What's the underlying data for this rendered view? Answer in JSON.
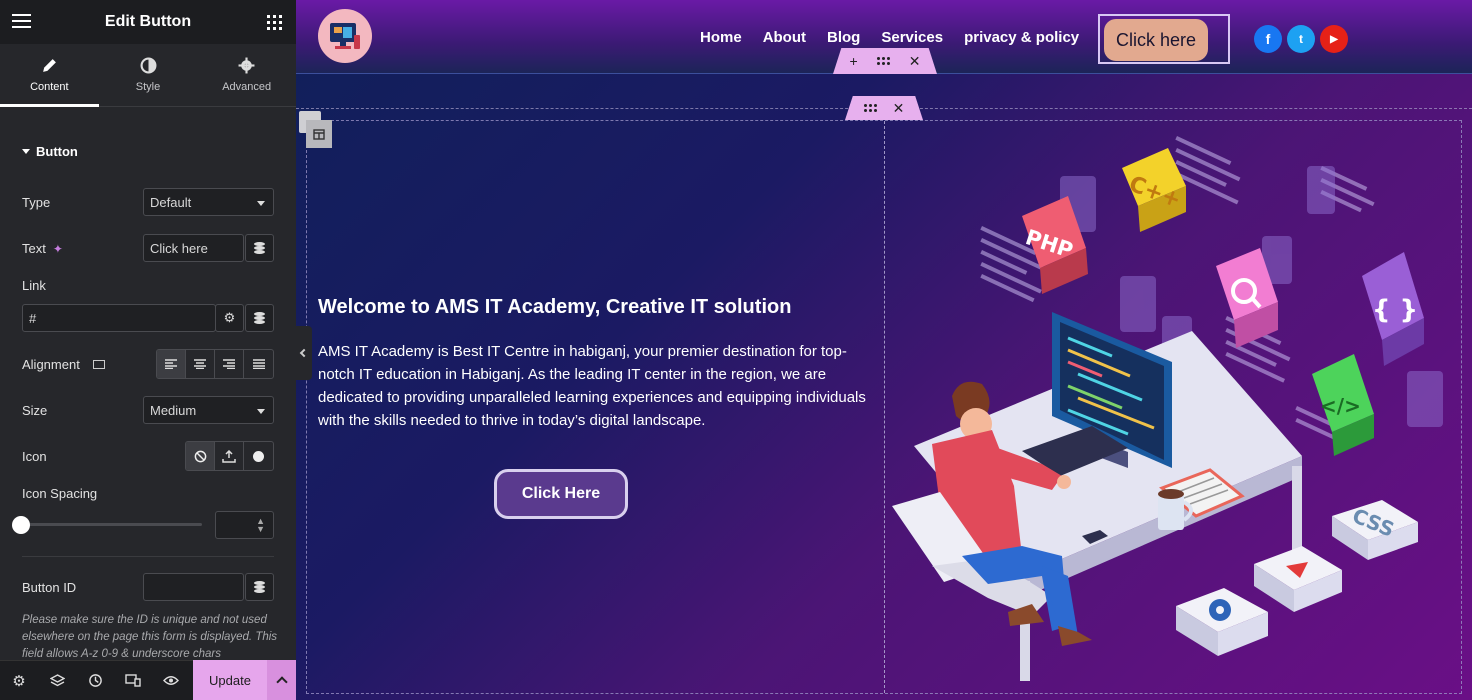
{
  "panel": {
    "title": "Edit Button",
    "tabs": [
      {
        "label": "Content"
      },
      {
        "label": "Style"
      },
      {
        "label": "Advanced"
      }
    ],
    "section_title": "Button",
    "fields": {
      "type": {
        "label": "Type",
        "value": "Default"
      },
      "text": {
        "label": "Text",
        "value": "Click here"
      },
      "link": {
        "label": "Link",
        "value": "#"
      },
      "alignment": {
        "label": "Alignment"
      },
      "size": {
        "label": "Size",
        "value": "Medium"
      },
      "icon": {
        "label": "Icon"
      },
      "icon_spacing": {
        "label": "Icon Spacing"
      },
      "button_id": {
        "label": "Button ID",
        "value": ""
      }
    },
    "note": "Please make sure the ID is unique and not used elsewhere on the page this form is displayed. This field allows A-z 0-9 & underscore chars",
    "update_label": "Update"
  },
  "site": {
    "nav": [
      "Home",
      "About",
      "Blog",
      "Services",
      "privacy & policy"
    ],
    "header_button": "Click here",
    "social": [
      {
        "name": "facebook-icon",
        "color": "#1877f2",
        "glyph": "f"
      },
      {
        "name": "twitter-icon",
        "color": "#1da1f2",
        "glyph": "t"
      },
      {
        "name": "youtube-icon",
        "color": "#e62117",
        "glyph": "▶"
      }
    ],
    "hero_title": "Welcome to AMS IT Academy, Creative IT solution",
    "hero_text": "AMS IT Academy is Best IT Centre in habiganj, your premier destination for top-notch IT education in Habiganj. As the leading IT center in the region, we are dedicated to providing unparalleled learning experiences and equipping individuals with the skills needed to thrive in today’s digital landscape.",
    "hero_button": "Click Here",
    "illustration": {
      "php": "PHP",
      "cpp": "C++",
      "css": "CSS",
      "code": "</>",
      "braces": "{ }"
    }
  },
  "colors": {
    "panel_bg": "#26272b",
    "update_bg": "#e6a6ec",
    "hero_btn_bg": "#5a3a8e",
    "header_btn_bg": "#e2a98f"
  }
}
